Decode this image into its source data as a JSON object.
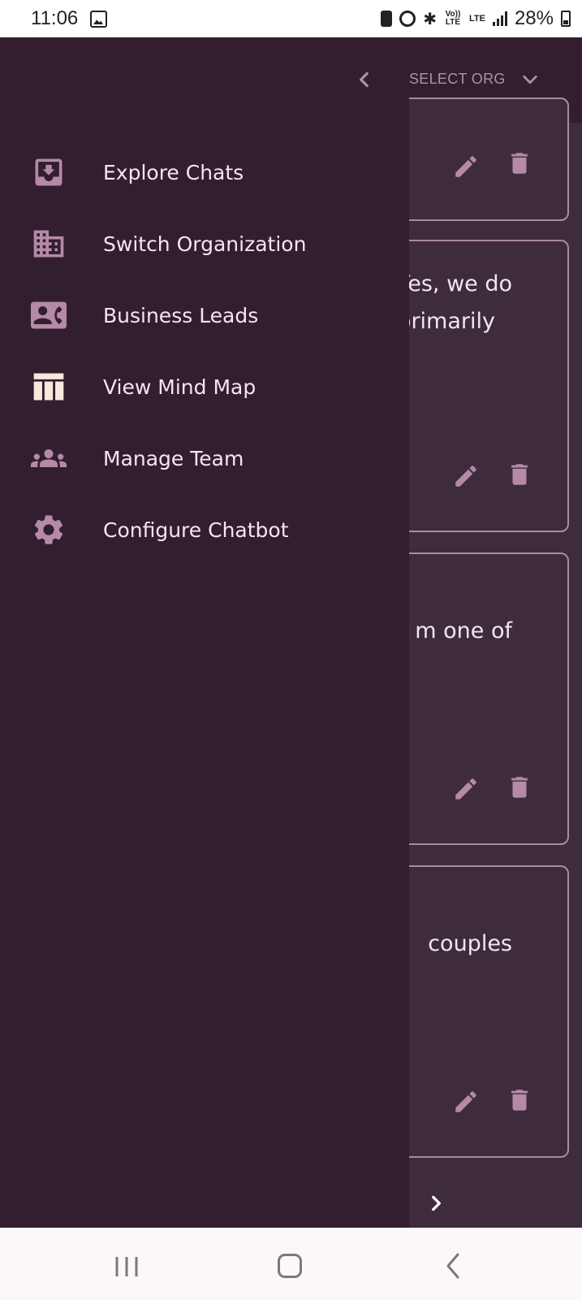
{
  "status_bar": {
    "time": "11:06",
    "volte_label": "Vo)) LTE",
    "lte_label": "LTE",
    "battery_percent": "28%",
    "icons": [
      "gallery-icon",
      "sim-icon",
      "alarm-icon",
      "bluetooth-icon",
      "volte-icon",
      "lte-icon",
      "signal-icon",
      "battery-icon"
    ]
  },
  "app_bar": {
    "org_selector_label": "SELECT ORG",
    "icons": [
      "chevron-left-icon",
      "chevron-down-icon"
    ]
  },
  "cards": [
    {
      "text": ""
    },
    {
      "text": "Yes, we do\nprimarily"
    },
    {
      "text": "m one of"
    },
    {
      "text": "couples"
    }
  ],
  "card_actions": {
    "icons": [
      "edit-icon",
      "delete-icon"
    ]
  },
  "drawer": {
    "items": [
      {
        "label": "Explore Chats",
        "icon": "inbox-download-icon"
      },
      {
        "label": "Switch Organization",
        "icon": "building-icon"
      },
      {
        "label": "Business Leads",
        "icon": "contact-card-icon"
      },
      {
        "label": "View Mind Map",
        "icon": "table-columns-icon"
      },
      {
        "label": "Manage Team",
        "icon": "group-icon"
      },
      {
        "label": "Configure Chatbot",
        "icon": "gear-icon"
      }
    ]
  },
  "colors": {
    "drawer_bg": "#321e2e",
    "content_bg": "#3e2c3c",
    "accent_icon": "#b48aa6",
    "text": "#f3e6ee",
    "card_border": "#a98aa0"
  },
  "nav_bar": {
    "icons": [
      "recents-icon",
      "home-icon",
      "back-icon"
    ]
  }
}
